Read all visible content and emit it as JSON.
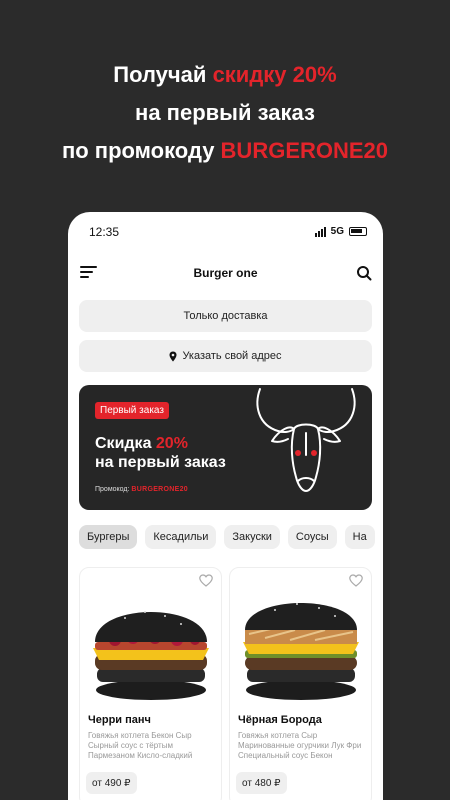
{
  "promo": {
    "line1_prefix": "Получай ",
    "line1_accent": "скидку 20%",
    "line2": "на первый заказ",
    "line3_prefix": "по промокоду ",
    "line3_accent": "BURGERONE20"
  },
  "status_bar": {
    "time": "12:35",
    "network": "5G"
  },
  "header": {
    "title": "Burger one"
  },
  "delivery_label": "Только доставка",
  "address_label": "Указать свой адрес",
  "banner": {
    "tag": "Первый заказ",
    "title_prefix": "Скидка ",
    "title_accent": "20%",
    "title_line2": "на первый заказ",
    "code_label": "Промокод:",
    "code_value": "BURGERONE20"
  },
  "categories": [
    "Бургеры",
    "Кесадильи",
    "Закуски",
    "Соусы",
    "На"
  ],
  "products": [
    {
      "name": "Черри панч",
      "desc": "Говяжья котлета Бекон Сыр Сырный соус с тёртым Пармезаном Кисло-сладкий",
      "price": "от 490 ₽"
    },
    {
      "name": "Чёрная Борода",
      "desc": "Говяжья котлета Сыр Маринованные огурчики Лук Фри Специальный соус Бекон",
      "price": "от 480 ₽"
    }
  ],
  "colors": {
    "accent": "#e3242b",
    "background": "#2b2b2b"
  }
}
